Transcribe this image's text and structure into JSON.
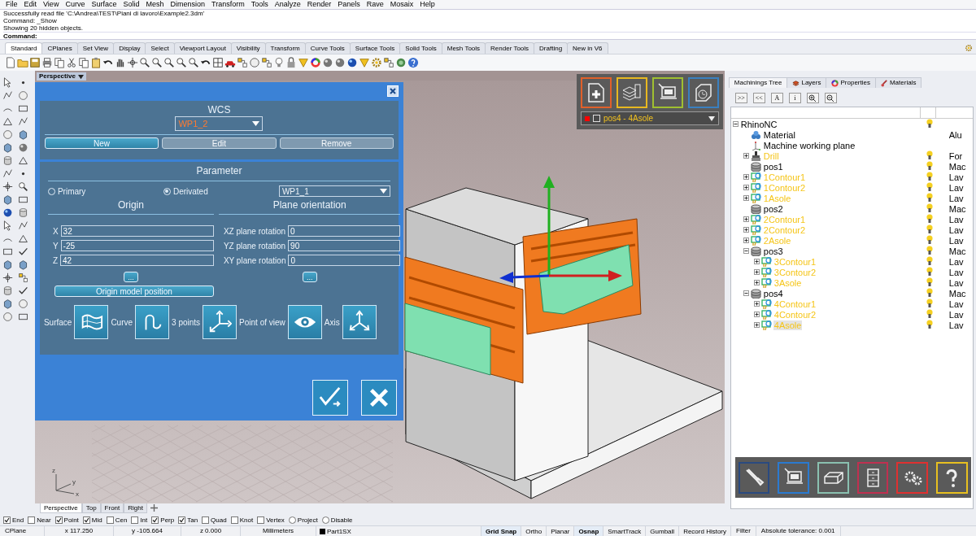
{
  "menu": [
    "File",
    "Edit",
    "View",
    "Curve",
    "Surface",
    "Solid",
    "Mesh",
    "Dimension",
    "Transform",
    "Tools",
    "Analyze",
    "Render",
    "Panels",
    "Rave",
    "Mosaix",
    "Help"
  ],
  "command_history": [
    "Successfully read file 'C:\\Andrea\\TEST\\Piani di lavoro\\Example2.3dm'",
    "Command: _Show",
    "Showing 20 hidden objects."
  ],
  "command_prompt": "Command:",
  "toolbar_tabs": [
    {
      "label": "Standard",
      "selected": true
    },
    {
      "label": "CPlanes",
      "selected": false
    },
    {
      "label": "Set View",
      "selected": false
    },
    {
      "label": "Display",
      "selected": false
    },
    {
      "label": "Select",
      "selected": false
    },
    {
      "label": "Viewport Layout",
      "selected": false
    },
    {
      "label": "Visibility",
      "selected": false
    },
    {
      "label": "Transform",
      "selected": false
    },
    {
      "label": "Curve Tools",
      "selected": false
    },
    {
      "label": "Surface Tools",
      "selected": false
    },
    {
      "label": "Solid Tools",
      "selected": false
    },
    {
      "label": "Mesh Tools",
      "selected": false
    },
    {
      "label": "Render Tools",
      "selected": false
    },
    {
      "label": "Drafting",
      "selected": false
    },
    {
      "label": "New in V6",
      "selected": false
    }
  ],
  "viewport": {
    "title": "Perspective",
    "axis_labels": [
      "z",
      "y",
      "x"
    ],
    "tabs": [
      {
        "label": "Perspective",
        "selected": true
      },
      {
        "label": "Top",
        "selected": false
      },
      {
        "label": "Front",
        "selected": false
      },
      {
        "label": "Right",
        "selected": false
      }
    ]
  },
  "wcs_dialog": {
    "title": "WCS",
    "wcs_select": "WP1_2",
    "buttons": [
      {
        "label": "New",
        "disabled": false
      },
      {
        "label": "Edit",
        "disabled": true
      },
      {
        "label": "Remove",
        "disabled": true
      }
    ],
    "parameter_title": "Parameter",
    "modes": [
      {
        "label": "Primary",
        "selected": false
      },
      {
        "label": "Derivated",
        "selected": true
      }
    ],
    "base_select": "WP1_1",
    "origin_title": "Origin",
    "origin_fields": [
      {
        "label": "X",
        "value": "32"
      },
      {
        "label": "Y",
        "value": "-25"
      },
      {
        "label": "Z",
        "value": "42"
      }
    ],
    "orientation_title": "Plane orientation",
    "orientation_fields": [
      {
        "label": "XZ plane rotation",
        "value": "0"
      },
      {
        "label": "YZ plane rotation",
        "value": "90"
      },
      {
        "label": "XY plane rotation",
        "value": "0"
      }
    ],
    "more_buttons": [
      "...",
      "..."
    ],
    "origin_model_button": "Origin model position",
    "methods": [
      {
        "label": "Surface",
        "kind": "surface"
      },
      {
        "label": "Curve",
        "kind": "curve"
      },
      {
        "label": "3 points",
        "kind": "points"
      },
      {
        "label": "Point of view",
        "kind": "view"
      },
      {
        "label": "Axis",
        "kind": "axis"
      }
    ]
  },
  "machining_toolbar": {
    "buttons": [
      {
        "kind": "new",
        "color": "#e0602a"
      },
      {
        "kind": "stack",
        "color": "#e8b820"
      },
      {
        "kind": "machine",
        "color": "#a0c030"
      },
      {
        "kind": "clock",
        "color": "#3a80c0"
      }
    ],
    "selector": {
      "label": "pos4 - 4Asole",
      "color": "#ff0000",
      "checked": false
    }
  },
  "panel": {
    "tabs": [
      {
        "label": "Machinings Tree",
        "kind": "plain",
        "selected": true
      },
      {
        "label": "Layers",
        "kind": "layers",
        "selected": false
      },
      {
        "label": "Properties",
        "kind": "properties",
        "selected": false
      },
      {
        "label": "Materials",
        "kind": "materials",
        "selected": false
      }
    ],
    "toolbar_buttons": [
      ">>",
      "<<",
      "A",
      "i"
    ],
    "tree": [
      {
        "label": "RhinoNC",
        "bulb": true,
        "expanded": true,
        "selected": false,
        "children": [
          {
            "label": "Material",
            "kind": "material",
            "bulb": false,
            "value": "Alu",
            "selected": false
          },
          {
            "label": "Machine working plane",
            "kind": "plane",
            "bulb": false,
            "selected": false
          },
          {
            "label": "Drill",
            "kind": "tool",
            "bulb": true,
            "expanded": false,
            "value": "For",
            "selected": false
          },
          {
            "label": "pos1",
            "kind": "position",
            "bulb": true,
            "value": "Mac",
            "selected": false
          },
          {
            "label": "1Contour1",
            "kind": "machining",
            "bulb": true,
            "expanded": false,
            "value": "Lav",
            "selected": false
          },
          {
            "label": "1Contour2",
            "kind": "machining",
            "bulb": true,
            "expanded": false,
            "value": "Lav",
            "selected": false
          },
          {
            "label": "1Asole",
            "kind": "machining",
            "bulb": true,
            "expanded": false,
            "value": "Lav",
            "selected": false
          },
          {
            "label": "pos2",
            "kind": "position",
            "bulb": true,
            "value": "Mac",
            "selected": false
          },
          {
            "label": "2Contour1",
            "kind": "machining",
            "bulb": true,
            "expanded": false,
            "value": "Lav",
            "selected": false
          },
          {
            "label": "2Contour2",
            "kind": "machining",
            "bulb": true,
            "expanded": false,
            "value": "Lav",
            "selected": false
          },
          {
            "label": "2Asole",
            "kind": "machining",
            "bulb": true,
            "expanded": false,
            "value": "Lav",
            "selected": false
          },
          {
            "label": "pos3",
            "kind": "position",
            "bulb": true,
            "expanded": true,
            "value": "Mac",
            "selected": false,
            "children": [
              {
                "label": "3Contour1",
                "kind": "machining",
                "bulb": true,
                "expanded": false,
                "value": "Lav",
                "selected": false
              },
              {
                "label": "3Contour2",
                "kind": "machining",
                "bulb": true,
                "expanded": false,
                "value": "Lav",
                "selected": false
              },
              {
                "label": "3Asole",
                "kind": "machining",
                "bulb": true,
                "expanded": false,
                "value": "Lav",
                "selected": false
              }
            ]
          },
          {
            "label": "pos4",
            "kind": "position",
            "bulb": true,
            "expanded": true,
            "value": "Mac",
            "selected": false,
            "children": [
              {
                "label": "4Contour1",
                "kind": "machining",
                "bulb": true,
                "expanded": false,
                "value": "Lav",
                "selected": false
              },
              {
                "label": "4Contour2",
                "kind": "machining",
                "bulb": true,
                "expanded": false,
                "value": "Lav",
                "selected": false
              },
              {
                "label": "4Asole",
                "kind": "machining",
                "bulb": true,
                "expanded": false,
                "value": "Lav",
                "selected": true
              }
            ]
          }
        ]
      }
    ]
  },
  "nc_buttons": [
    {
      "kind": "tool",
      "color": "#2a4a80"
    },
    {
      "kind": "machine",
      "color": "#2a7ad0"
    },
    {
      "kind": "stock",
      "color": "#8ac0b0"
    },
    {
      "kind": "cabinet",
      "color": "#c03050"
    },
    {
      "kind": "gears",
      "color": "#e03030"
    },
    {
      "kind": "help",
      "color": "#e8c020"
    }
  ],
  "osnaps": [
    {
      "label": "End",
      "kind": "check",
      "checked": true
    },
    {
      "label": "Near",
      "kind": "check",
      "checked": false
    },
    {
      "label": "Point",
      "kind": "check",
      "checked": true
    },
    {
      "label": "Mid",
      "kind": "check",
      "checked": true
    },
    {
      "label": "Cen",
      "kind": "check",
      "checked": false
    },
    {
      "label": "Int",
      "kind": "check",
      "checked": false
    },
    {
      "label": "Perp",
      "kind": "check",
      "checked": true
    },
    {
      "label": "Tan",
      "kind": "check",
      "checked": true
    },
    {
      "label": "Quad",
      "kind": "check",
      "checked": false
    },
    {
      "label": "Knot",
      "kind": "check",
      "checked": false
    },
    {
      "label": "Vertex",
      "kind": "check",
      "checked": false
    },
    {
      "label": "Project",
      "kind": "radio",
      "checked": false
    },
    {
      "label": "Disable",
      "kind": "radio",
      "checked": false
    }
  ],
  "status_bar": {
    "fields": [
      "CPlane",
      "x 117.250",
      "y -105.664",
      "z 0.000",
      "Millimeters"
    ],
    "layer": {
      "name": "Part1SX",
      "color": "#000000"
    },
    "toggles": [
      {
        "label": "Grid Snap",
        "on": true
      },
      {
        "label": "Ortho",
        "on": false
      },
      {
        "label": "Planar",
        "on": false
      },
      {
        "label": "Osnap",
        "on": true
      },
      {
        "label": "SmartTrack",
        "on": false
      },
      {
        "label": "Gumball",
        "on": false
      },
      {
        "label": "Record History",
        "on": false
      }
    ],
    "trailing": [
      "Filter",
      "Absolute tolerance: 0.001"
    ]
  }
}
